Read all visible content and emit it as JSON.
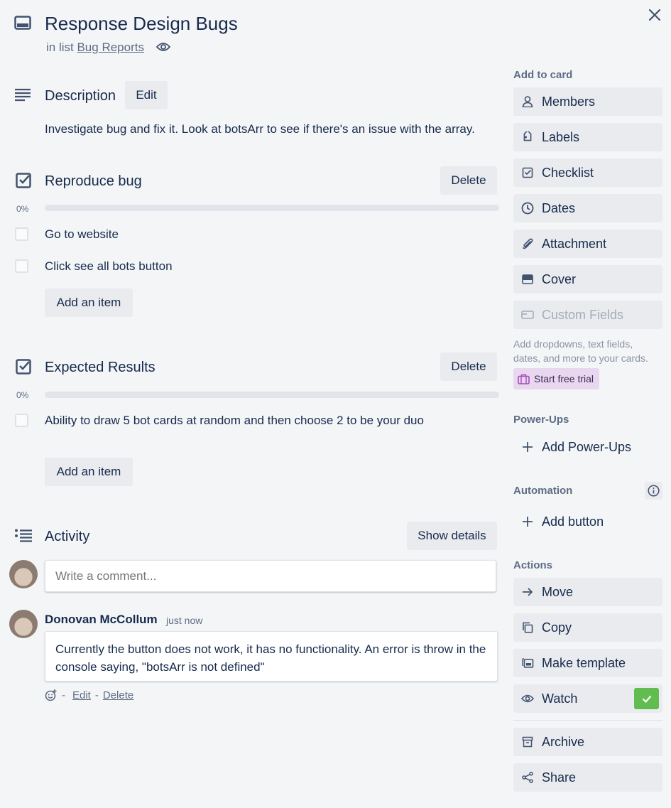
{
  "header": {
    "title": "Response Design Bugs",
    "in_list_prefix": "in list",
    "list_name": "Bug Reports"
  },
  "description": {
    "title": "Description",
    "edit_label": "Edit",
    "text": "Investigate bug and fix it. Look at botsArr to see if there's an issue with the array."
  },
  "checklists": [
    {
      "title": "Reproduce bug",
      "delete_label": "Delete",
      "progress": "0%",
      "items": [
        "Go to website",
        "Click see all bots button"
      ],
      "add_label": "Add an item"
    },
    {
      "title": "Expected Results",
      "delete_label": "Delete",
      "progress": "0%",
      "items": [
        "Ability to draw 5 bot cards at random and then choose 2 to be your duo"
      ],
      "add_label": "Add an item"
    }
  ],
  "activity": {
    "title": "Activity",
    "show_details_label": "Show details",
    "comment_placeholder": "Write a comment...",
    "comments": [
      {
        "author": "Donovan McCollum",
        "time": "just now",
        "text": "Currently the button does not work, it has no functionality. An error is throw in the console saying, \"botsArr is not defined\"",
        "edit_label": "Edit",
        "delete_label": "Delete",
        "sep": "-"
      }
    ]
  },
  "sidebar": {
    "add_to_card_heading": "Add to card",
    "add_items": [
      {
        "label": "Members",
        "icon": "person-icon"
      },
      {
        "label": "Labels",
        "icon": "tag-icon"
      },
      {
        "label": "Checklist",
        "icon": "checkbox-icon"
      },
      {
        "label": "Dates",
        "icon": "clock-icon"
      },
      {
        "label": "Attachment",
        "icon": "paperclip-icon"
      },
      {
        "label": "Cover",
        "icon": "cover-icon"
      },
      {
        "label": "Custom Fields",
        "icon": "custom-fields-icon"
      }
    ],
    "custom_fields_hint": "Add dropdowns, text fields, dates, and more to your cards.",
    "trial_label": "Start free trial",
    "powerups_heading": "Power-Ups",
    "add_powerups_label": "Add Power-Ups",
    "automation_heading": "Automation",
    "add_button_label": "Add button",
    "actions_heading": "Actions",
    "actions": [
      {
        "label": "Move",
        "icon": "arrow-right-icon"
      },
      {
        "label": "Copy",
        "icon": "copy-icon"
      },
      {
        "label": "Make template",
        "icon": "template-icon"
      },
      {
        "label": "Watch",
        "icon": "eye-icon"
      },
      {
        "label": "Archive",
        "icon": "archive-icon"
      },
      {
        "label": "Share",
        "icon": "share-icon"
      }
    ]
  },
  "colors": {
    "accent_green": "#61bd4f",
    "trial_bg": "#e9d7f0",
    "trial_text": "#3c2d55"
  }
}
